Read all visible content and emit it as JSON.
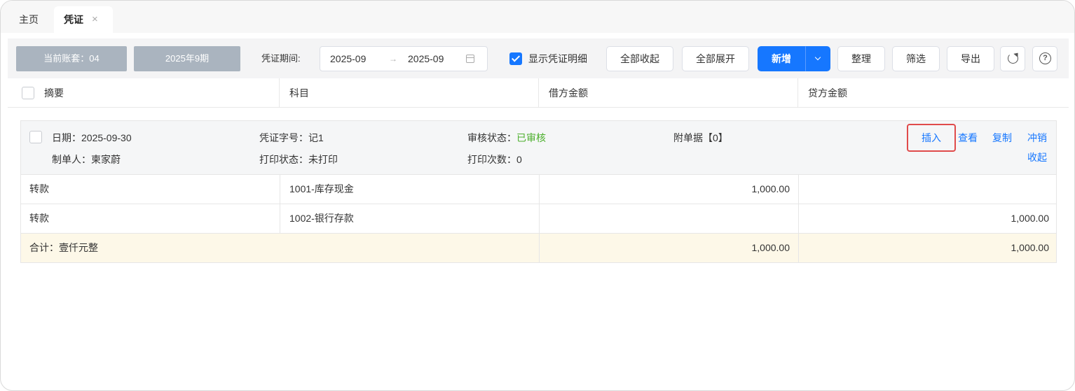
{
  "tabs": {
    "home": "主页",
    "voucher": "凭证",
    "close": "×"
  },
  "toolbar": {
    "account_chip": "当前账套：04",
    "period_chip": "2025年9期",
    "period_label": "凭证期间:",
    "date_start": "2025-09",
    "date_sep": "→",
    "date_end": "2025-09",
    "show_detail_label": "显示凭证明细",
    "show_detail_checked": true,
    "collapse_all": "全部收起",
    "expand_all": "全部展开",
    "new": "新增",
    "tidy": "整理",
    "filter": "筛选",
    "export": "导出",
    "help": "?"
  },
  "columns": {
    "summary": "摘要",
    "account": "科目",
    "debit": "借方金额",
    "credit": "贷方金额"
  },
  "voucher": {
    "date": "日期：2025-09-30",
    "number": "凭证字号：记1",
    "audit_label": "审核状态：",
    "audit_value": "已审核",
    "attachments": "附单据【0】",
    "creator": "制单人：柬家蔚",
    "print_status": "打印状态：未打印",
    "print_count": "打印次数：0",
    "actions": {
      "insert": "插入",
      "view": "查看",
      "copy": "复制",
      "reverse": "冲销",
      "collapse": "收起"
    },
    "entries": [
      {
        "summary": "转款",
        "account": "1001-库存现金",
        "debit": "1,000.00",
        "credit": ""
      },
      {
        "summary": "转款",
        "account": "1002-银行存款",
        "debit": "",
        "credit": "1,000.00"
      }
    ],
    "total": {
      "label": "合计：壹仟元整",
      "debit": "1,000.00",
      "credit": "1,000.00"
    }
  },
  "colors": {
    "accent": "#1677ff",
    "approved": "#4caf2c",
    "highlight_box": "#e04b4b",
    "total_row": "#fdf8e8",
    "chip": "#aab4bf"
  }
}
